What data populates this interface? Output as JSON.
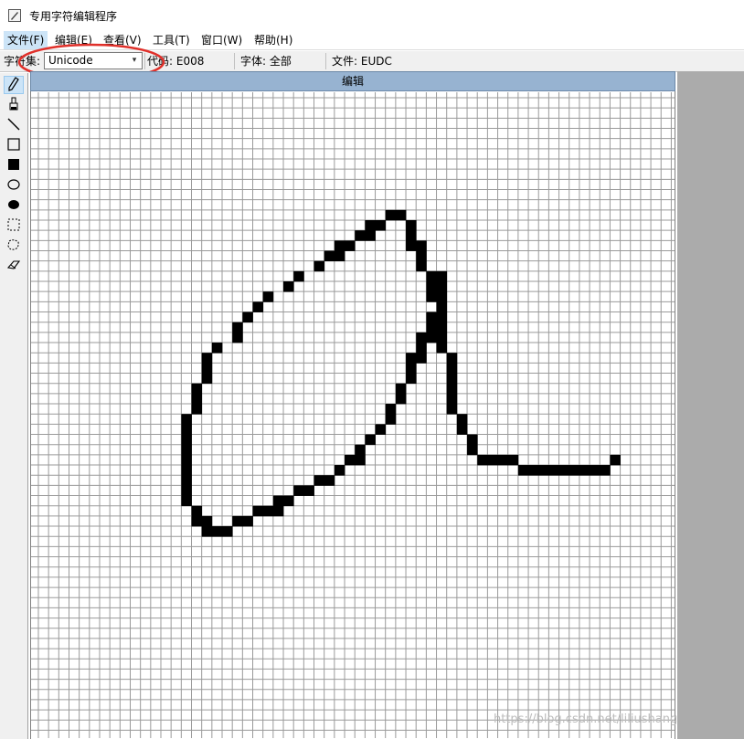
{
  "window": {
    "title": "专用字符编辑程序"
  },
  "menu": [
    {
      "label": "文件(F)",
      "active": true
    },
    {
      "label": "编辑(E)",
      "active": false
    },
    {
      "label": "查看(V)",
      "active": false
    },
    {
      "label": "工具(T)",
      "active": false
    },
    {
      "label": "窗口(W)",
      "active": false
    },
    {
      "label": "帮助(H)",
      "active": false
    }
  ],
  "statusbar": {
    "charset_label": "字符集:",
    "charset_value": "Unicode",
    "code": "代码: E008",
    "font": "字体: 全部",
    "file": "文件: EUDC"
  },
  "tools": [
    "pencil-icon",
    "brush-icon",
    "line-icon",
    "rectangle-hollow-icon",
    "rectangle-filled-icon",
    "ellipse-hollow-icon",
    "ellipse-filled-icon",
    "rect-select-icon",
    "freeform-select-icon",
    "eraser-icon"
  ],
  "editor": {
    "title": "编辑",
    "glyph_pixels": [
      [
        34,
        11
      ],
      [
        35,
        11
      ],
      [
        32,
        12
      ],
      [
        33,
        12
      ],
      [
        36,
        12
      ],
      [
        31,
        13
      ],
      [
        32,
        13
      ],
      [
        36,
        13
      ],
      [
        29,
        14
      ],
      [
        30,
        14
      ],
      [
        36,
        14
      ],
      [
        37,
        14
      ],
      [
        28,
        15
      ],
      [
        29,
        15
      ],
      [
        37,
        15
      ],
      [
        27,
        16
      ],
      [
        37,
        16
      ],
      [
        25,
        17
      ],
      [
        38,
        17
      ],
      [
        39,
        17
      ],
      [
        24,
        18
      ],
      [
        38,
        18
      ],
      [
        39,
        18
      ],
      [
        22,
        19
      ],
      [
        38,
        19
      ],
      [
        39,
        19
      ],
      [
        21,
        20
      ],
      [
        39,
        20
      ],
      [
        20,
        21
      ],
      [
        38,
        21
      ],
      [
        39,
        21
      ],
      [
        19,
        22
      ],
      [
        38,
        22
      ],
      [
        39,
        22
      ],
      [
        19,
        23
      ],
      [
        37,
        23
      ],
      [
        38,
        23
      ],
      [
        39,
        23
      ],
      [
        17,
        24
      ],
      [
        37,
        24
      ],
      [
        39,
        24
      ],
      [
        16,
        25
      ],
      [
        36,
        25
      ],
      [
        37,
        25
      ],
      [
        40,
        25
      ],
      [
        16,
        26
      ],
      [
        36,
        26
      ],
      [
        40,
        26
      ],
      [
        16,
        27
      ],
      [
        36,
        27
      ],
      [
        40,
        27
      ],
      [
        15,
        28
      ],
      [
        35,
        28
      ],
      [
        40,
        28
      ],
      [
        15,
        29
      ],
      [
        35,
        29
      ],
      [
        40,
        29
      ],
      [
        15,
        30
      ],
      [
        34,
        30
      ],
      [
        40,
        30
      ],
      [
        14,
        31
      ],
      [
        34,
        31
      ],
      [
        41,
        31
      ],
      [
        14,
        32
      ],
      [
        33,
        32
      ],
      [
        41,
        32
      ],
      [
        14,
        33
      ],
      [
        32,
        33
      ],
      [
        42,
        33
      ],
      [
        14,
        34
      ],
      [
        31,
        34
      ],
      [
        42,
        34
      ],
      [
        14,
        35
      ],
      [
        30,
        35
      ],
      [
        31,
        35
      ],
      [
        43,
        35
      ],
      [
        44,
        35
      ],
      [
        45,
        35
      ],
      [
        46,
        35
      ],
      [
        14,
        36
      ],
      [
        29,
        36
      ],
      [
        47,
        36
      ],
      [
        48,
        36
      ],
      [
        49,
        36
      ],
      [
        50,
        36
      ],
      [
        51,
        36
      ],
      [
        52,
        36
      ],
      [
        53,
        36
      ],
      [
        54,
        36
      ],
      [
        55,
        36
      ],
      [
        14,
        37
      ],
      [
        27,
        37
      ],
      [
        28,
        37
      ],
      [
        14,
        38
      ],
      [
        25,
        38
      ],
      [
        26,
        38
      ],
      [
        14,
        39
      ],
      [
        23,
        39
      ],
      [
        24,
        39
      ],
      [
        15,
        40
      ],
      [
        21,
        40
      ],
      [
        22,
        40
      ],
      [
        23,
        40
      ],
      [
        15,
        41
      ],
      [
        16,
        41
      ],
      [
        19,
        41
      ],
      [
        20,
        41
      ],
      [
        16,
        42
      ],
      [
        17,
        42
      ],
      [
        18,
        42
      ],
      [
        56,
        35
      ]
    ],
    "grid_cols": 62,
    "grid_rows": 63
  },
  "annotation": {
    "color": "#e0302a"
  },
  "watermark": "https://blog.csdn.net/liliushang"
}
